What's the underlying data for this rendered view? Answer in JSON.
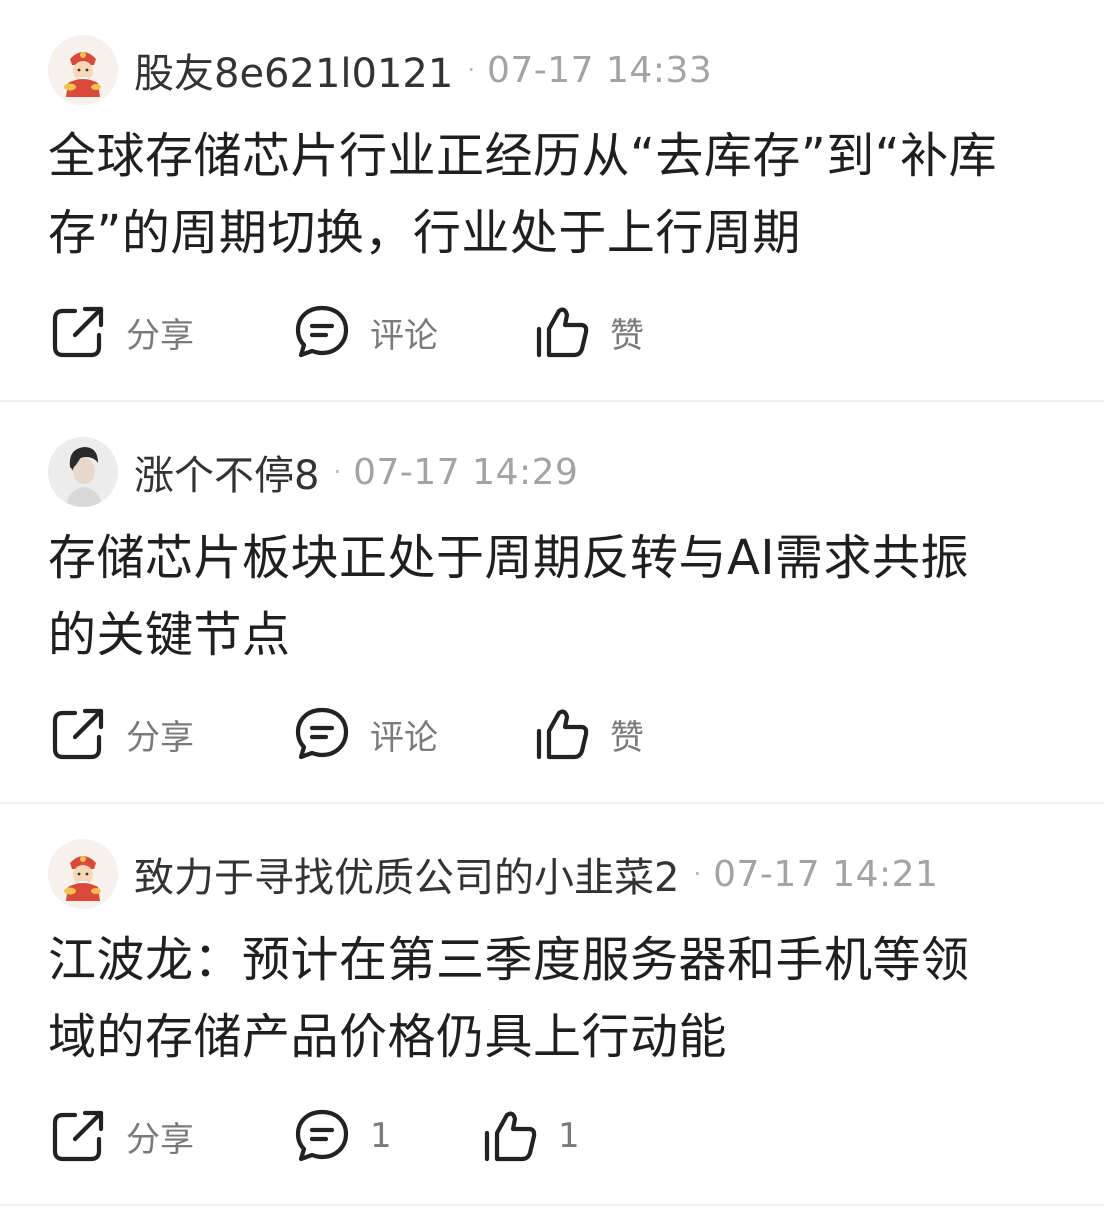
{
  "posts": [
    {
      "author": "股友8e621l0121",
      "separator": "·",
      "time": "07-17 14:33",
      "avatar_icon": "fortune-god-avatar-icon",
      "lines": [
        "全球存储芯片行业正经历从“去库存”到“补库",
        "存”的周期切换，行业处于上行周期"
      ],
      "actions": {
        "share": "分享",
        "comment": "评论",
        "like": "赞"
      }
    },
    {
      "author": "涨个不停8",
      "separator": "·",
      "time": "07-17 14:29",
      "avatar_icon": "person-photo-avatar-icon",
      "lines": [
        "存储芯片板块正处于周期反转与AI需求共振",
        "的关键节点"
      ],
      "actions": {
        "share": "分享",
        "comment": "评论",
        "like": "赞"
      }
    },
    {
      "author": "致力于寻找优质公司的小韭菜2",
      "separator": "·",
      "time": "07-17 14:21",
      "avatar_icon": "fortune-god-avatar-icon",
      "lines": [
        "江波龙：预计在第三季度服务器和手机等领",
        "域的存储产品价格仍具上行动能"
      ],
      "actions": {
        "share": "分享",
        "comment": "1",
        "like": "1"
      }
    }
  ],
  "colors": {
    "text_primary": "#1f1f1f",
    "text_author": "#333333",
    "text_meta": "#a3a3a3",
    "icon_stroke": "#222222",
    "divider": "#eeeeee"
  }
}
